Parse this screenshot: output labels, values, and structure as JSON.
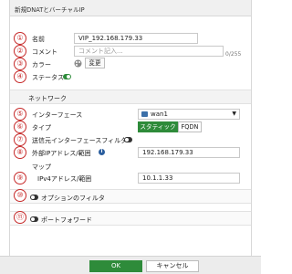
{
  "title": "新規DNATとバーチャルIP",
  "markers": [
    "①",
    "②",
    "③",
    "④",
    "⑤",
    "⑥",
    "⑦",
    "⑧",
    "⑨",
    "⑩",
    "⑪"
  ],
  "fields": {
    "name_label": "名前",
    "name_value": "VIP_192.168.179.33",
    "comment_label": "コメント",
    "comment_placeholder": "コメント記入...",
    "comment_counter": "0/255",
    "color_label": "カラー",
    "color_button": "変更",
    "status_label": "ステータス"
  },
  "network": {
    "section_label": "ネットワーク",
    "interface_label": "インターフェース",
    "interface_value": "wan1",
    "type_label": "タイプ",
    "type_options": [
      "スタティックNAT",
      "FQDN"
    ],
    "src_filter_label": "送信元インターフェースフィルタ",
    "ext_ip_label": "外部IPアドレス/範囲",
    "ext_ip_value": "192.168.179.33",
    "map_label": "マップ",
    "ipv4_label": "IPv4アドレス/範囲",
    "ipv4_value": "10.1.1.33"
  },
  "options": {
    "optional_filter_label": "オプションのフィルタ",
    "port_forward_label": "ポートフォワード"
  },
  "footer": {
    "ok_label": "OK",
    "cancel_label": "キャンセル"
  },
  "colors": {
    "accent_green": "#2e8b3a",
    "marker_red": "#c62828"
  }
}
